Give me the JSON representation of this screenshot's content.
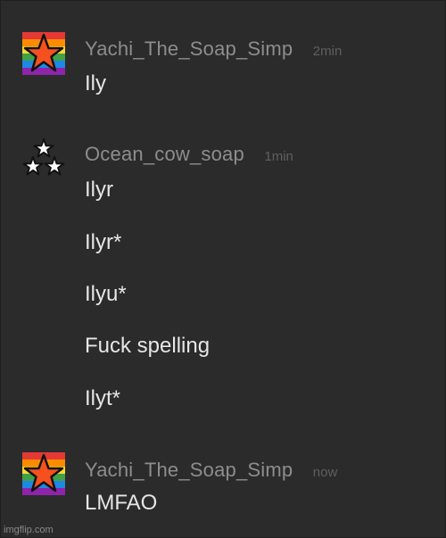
{
  "messages": [
    {
      "avatar_icon": "rainbow-star-avatar-icon",
      "username": "Yachi_The_Soap_Simp",
      "timestamp": "2min",
      "lines": [
        "Ily"
      ]
    },
    {
      "avatar_icon": "three-stars-avatar-icon",
      "username": "Ocean_cow_soap",
      "timestamp": "1min",
      "lines": [
        "Ilyr",
        "Ilyr*",
        "Ilyu*",
        "Fuck spelling",
        "Ilyt*"
      ]
    },
    {
      "avatar_icon": "rainbow-star-avatar-icon",
      "username": "Yachi_The_Soap_Simp",
      "timestamp": "now",
      "lines": [
        "LMFAO"
      ]
    }
  ],
  "watermark": "imgflip.com",
  "colors": {
    "background": "#2b2b2b",
    "username": "#8d8d8d",
    "timestamp": "#5f5f5f",
    "message_text": "#e6e6e6"
  }
}
